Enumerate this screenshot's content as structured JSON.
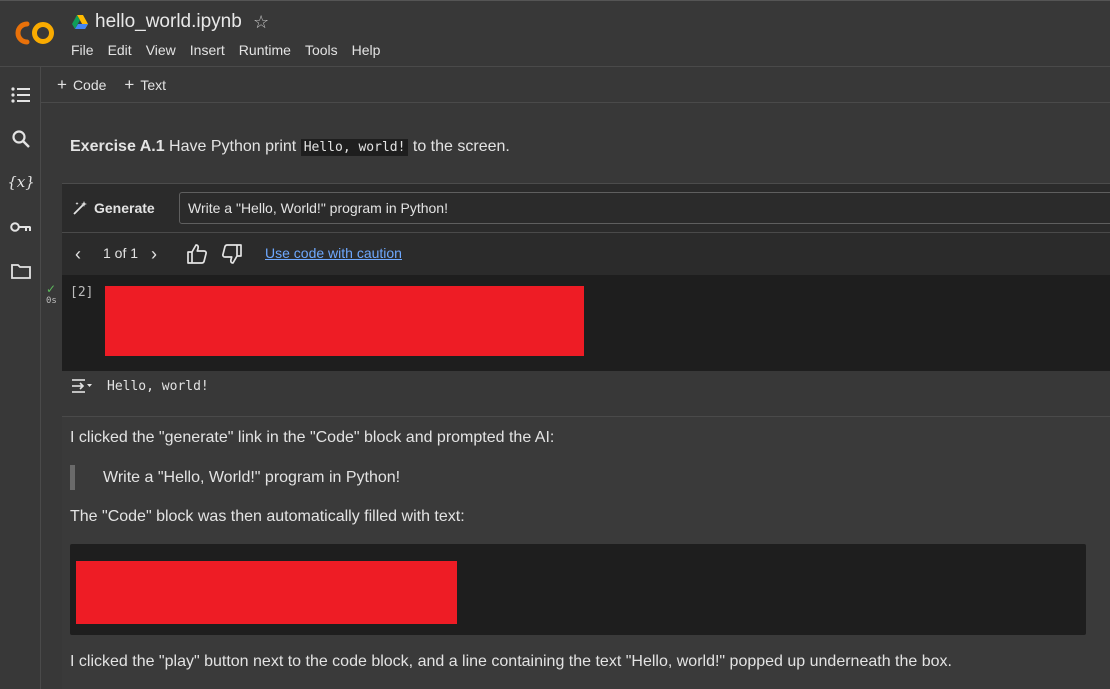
{
  "header": {
    "title": "hello_world.ipynb",
    "menu": [
      "File",
      "Edit",
      "View",
      "Insert",
      "Runtime",
      "Tools",
      "Help"
    ]
  },
  "toolbar": {
    "code_label": "Code",
    "text_label": "Text"
  },
  "exercise": {
    "label": "Exercise A.1",
    "text_before": "Have Python print",
    "code": "Hello, world!",
    "text_after": "to the screen."
  },
  "generate": {
    "button_label": "Generate",
    "prompt_value": "Write a \"Hello, World!\" program in Python!",
    "pager": "1 of 1",
    "caution_link": "Use code with caution"
  },
  "code_cell": {
    "exec_count": "[2]",
    "run_time": "0s"
  },
  "output": {
    "text": "Hello, world!"
  },
  "text_cell": {
    "p1": "I clicked the \"generate\" link in the \"Code\" block and prompted the AI:",
    "quote": "Write a \"Hello, World!\" program in Python!",
    "p2": "The \"Code\" block was then automatically filled with text:",
    "p3": "I clicked the \"play\" button next to the code block, and a line containing the text \"Hello, world!\" popped up underneath the box."
  },
  "colors": {
    "accent_link": "#6ea8fe",
    "redaction": "#ee1c25",
    "logo_orange": "#f9ab00"
  }
}
